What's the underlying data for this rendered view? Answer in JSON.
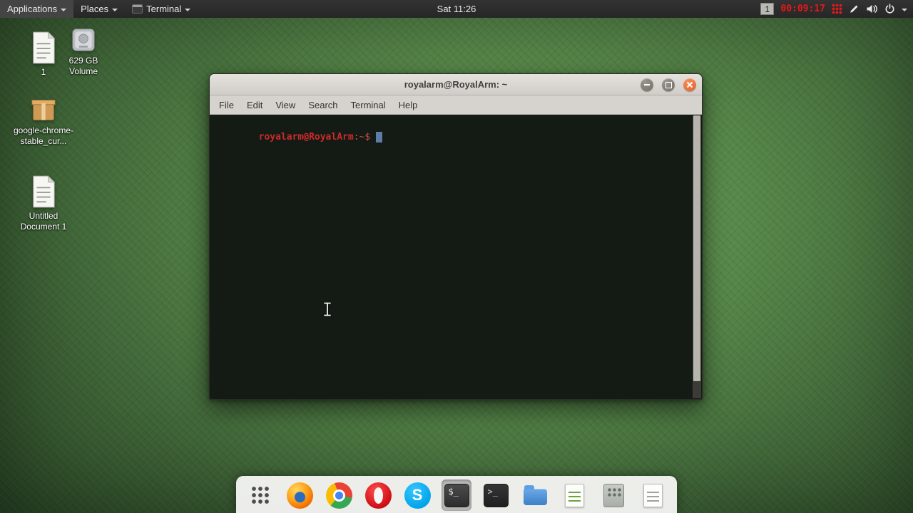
{
  "panel": {
    "applications_label": "Applications",
    "places_label": "Places",
    "active_app_label": "Terminal",
    "clock": "Sat 11:26",
    "workspace_number": "1",
    "recorder_timer": "00:09:17"
  },
  "desktop": {
    "icons": [
      {
        "label": "1"
      },
      {
        "label": "629 GB Volume"
      },
      {
        "label": "google-chrome-stable_cur..."
      },
      {
        "label": "Untitled Document 1"
      }
    ]
  },
  "window": {
    "title": "royalarm@RoyalArm: ~",
    "menu_items": [
      "File",
      "Edit",
      "View",
      "Search",
      "Terminal",
      "Help"
    ],
    "terminal": {
      "user_host": "royalarm@RoyalArm",
      "prompt_suffix": ":~$"
    }
  },
  "dock": {
    "glyphs": {
      "terminal_active": "$_",
      "terminal": ">_",
      "skype": "S"
    }
  },
  "colors": {
    "panel_bg": "#2b2b2b",
    "wallpaper_green": "#58894a",
    "terminal_bg": "#141a14",
    "prompt_red": "#cc2b2b",
    "close_button_orange": "#e65c23",
    "timer_red": "#e81717",
    "cursor_blue": "#5b7da6"
  }
}
